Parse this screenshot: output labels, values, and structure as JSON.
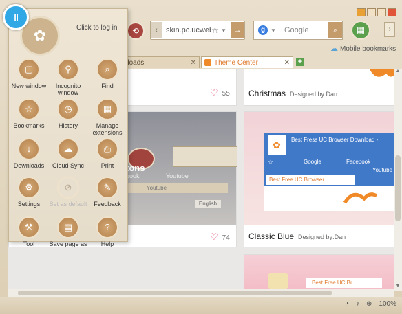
{
  "toolbar": {
    "address": "skin.pc.ucweb",
    "search_placeholder": "Google",
    "mobile_bookmarks": "Mobile bookmarks"
  },
  "tabs": [
    {
      "label": "ownloads"
    },
    {
      "label": "Theme Center"
    }
  ],
  "menu": {
    "login": "Click to log in",
    "items": [
      {
        "label": "New window",
        "icon": "window-icon"
      },
      {
        "label": "Incognito window",
        "icon": "incognito-icon"
      },
      {
        "label": "Find",
        "icon": "find-icon"
      },
      {
        "label": "Bookmarks",
        "icon": "bookmark-star-icon"
      },
      {
        "label": "History",
        "icon": "history-clock-icon"
      },
      {
        "label": "Manage extensions",
        "icon": "extensions-icon"
      },
      {
        "label": "Downloads",
        "icon": "download-icon"
      },
      {
        "label": "Cloud Sync",
        "icon": "cloud-sync-icon"
      },
      {
        "label": "Print",
        "icon": "print-icon"
      },
      {
        "label": "Settings",
        "icon": "settings-gear-icon"
      },
      {
        "label": "Set as default",
        "icon": "set-default-icon"
      },
      {
        "label": "Feedback",
        "icon": "feedback-pencil-icon"
      },
      {
        "label": "Tool",
        "icon": "tool-wrench-icon"
      },
      {
        "label": "Save page as",
        "icon": "save-page-icon"
      },
      {
        "label": "Help",
        "icon": "help-icon"
      }
    ]
  },
  "cards": [
    {
      "title": "",
      "designer": "",
      "likes": "55"
    },
    {
      "title": "Christmas",
      "designer": "Designed by:Dan"
    },
    {
      "title": "",
      "designer": "",
      "likes": "74"
    },
    {
      "title": "Classic Blue",
      "designer": "Designed by:Dan"
    }
  ],
  "preview_blue": {
    "tab_title": "Best Fress UC Browser Download -",
    "search": "Google",
    "facebook": "Facebook",
    "youtube": "Youtube",
    "active_tab": "Best Free UC Browser"
  },
  "preview_left": {
    "partial_text": "tons",
    "book": "book",
    "youtube": "Youtube",
    "youtube2": "Youtube",
    "english": "English"
  },
  "preview_pink": {
    "tab": "Best Free UC Br"
  },
  "status": {
    "zoom": "100%"
  }
}
